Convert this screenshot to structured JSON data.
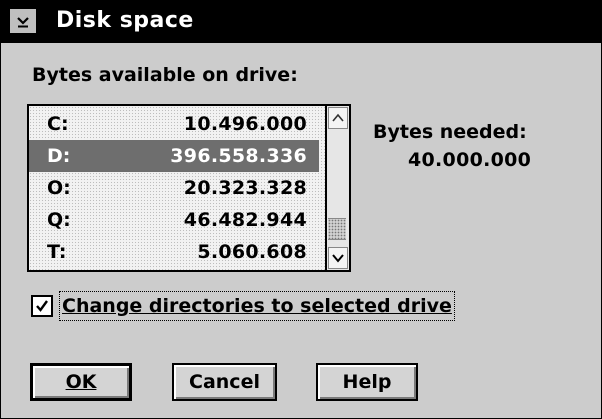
{
  "window": {
    "title": "Disk space",
    "system_menu_icon": "chevron-down-icon"
  },
  "available": {
    "label": "Bytes available on drive:",
    "drives": [
      {
        "drive": "C:",
        "bytes": "10.496.000",
        "selected": false
      },
      {
        "drive": "D:",
        "bytes": "396.558.336",
        "selected": true
      },
      {
        "drive": "O:",
        "bytes": "20.323.328",
        "selected": false
      },
      {
        "drive": "Q:",
        "bytes": "46.482.944",
        "selected": false
      },
      {
        "drive": "T:",
        "bytes": "5.060.608",
        "selected": false
      }
    ]
  },
  "needed": {
    "label": "Bytes needed:",
    "value": "40.000.000"
  },
  "change_dirs": {
    "label": "Change directories to selected drive",
    "checked": true
  },
  "buttons": {
    "ok": "OK",
    "cancel": "Cancel",
    "help": "Help"
  },
  "colors": {
    "title_bar": "#000000",
    "selection": "#6e6e6e",
    "dialog_bg": "#cccccc"
  }
}
